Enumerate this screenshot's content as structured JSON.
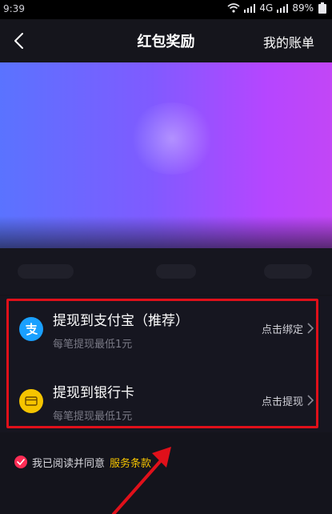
{
  "status": {
    "time": "9:39",
    "network": "4G",
    "battery": "89%"
  },
  "nav": {
    "title": "红包奖励",
    "right_link": "我的账单"
  },
  "withdraw_options": [
    {
      "icon": "alipay-icon",
      "title": "提现到支付宝（推荐）",
      "subtitle": "每笔提现最低1元",
      "action": "点击绑定"
    },
    {
      "icon": "bank-card-icon",
      "title": "提现到银行卡",
      "subtitle": "每笔提现最低1元",
      "action": "点击提现"
    }
  ],
  "agreement": {
    "text": "我已阅读并同意",
    "link": "服务条款"
  },
  "colors": {
    "accent_red": "#e0101a",
    "alipay_blue": "#1aa0ff",
    "bank_yellow": "#f5c400",
    "check_pink": "#ff2d55",
    "terms_yellow": "#f5c400"
  }
}
